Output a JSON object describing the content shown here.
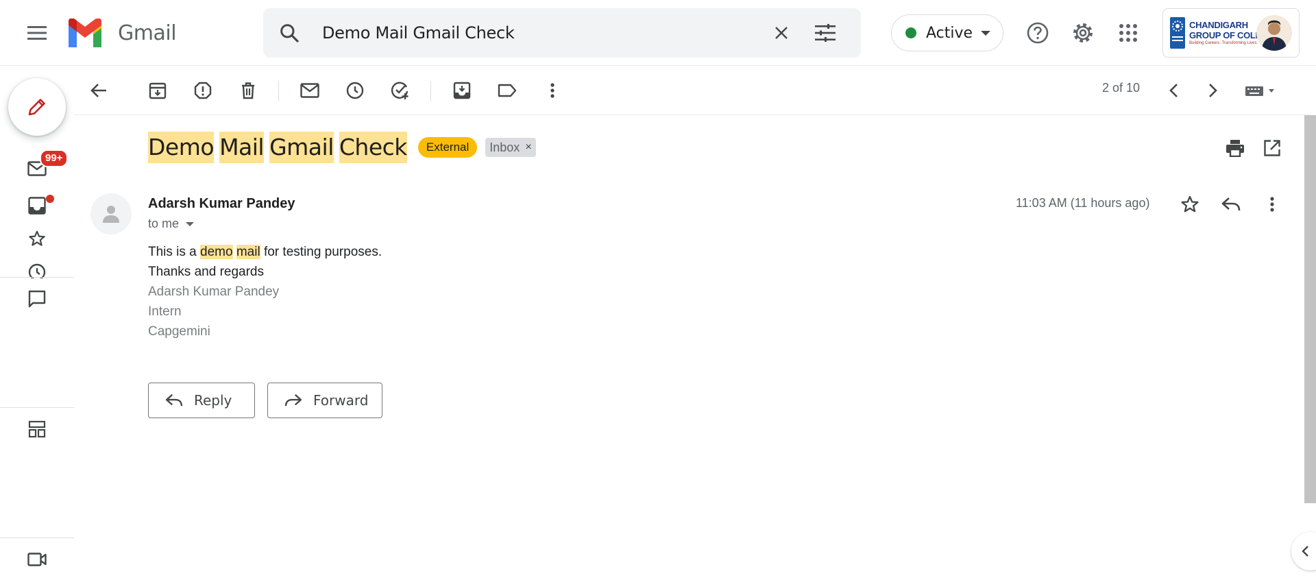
{
  "app": {
    "name": "Gmail"
  },
  "search": {
    "value": "Demo Mail Gmail Check"
  },
  "status": {
    "label": "Active",
    "dot_color": "#1e8e3e"
  },
  "org": {
    "line1": "CHANDIGARH",
    "line2": "GROUP OF COLLEGES",
    "tagline": "Building Careers. Transforming Lives.",
    "logo_text": "CGC"
  },
  "rail": {
    "mail_badge": "99+"
  },
  "toolbar": {
    "pager": "2 of 10"
  },
  "message": {
    "subject_words": [
      "Demo",
      "Mail",
      "Gmail",
      "Check"
    ],
    "label_external": "External",
    "label_inbox": "Inbox",
    "label_remove": "×",
    "sender": "Adarsh Kumar Pandey",
    "recipient": "to me",
    "time": "11:03 AM (11 hours ago)",
    "body": {
      "line1_prefix": "This is a ",
      "line1_hl1": "demo",
      "line1_hl2": "mail",
      "line1_suffix": " for testing purposes.",
      "line2": "Thanks and regards",
      "sig_name": "Adarsh Kumar Pandey",
      "sig_role": "Intern",
      "sig_company": "Capgemini"
    }
  },
  "actions": {
    "reply": "Reply",
    "forward": "Forward"
  },
  "colors": {
    "highlight": "#fde293",
    "external_label": "#fbbc04",
    "badge": "#d93025"
  }
}
